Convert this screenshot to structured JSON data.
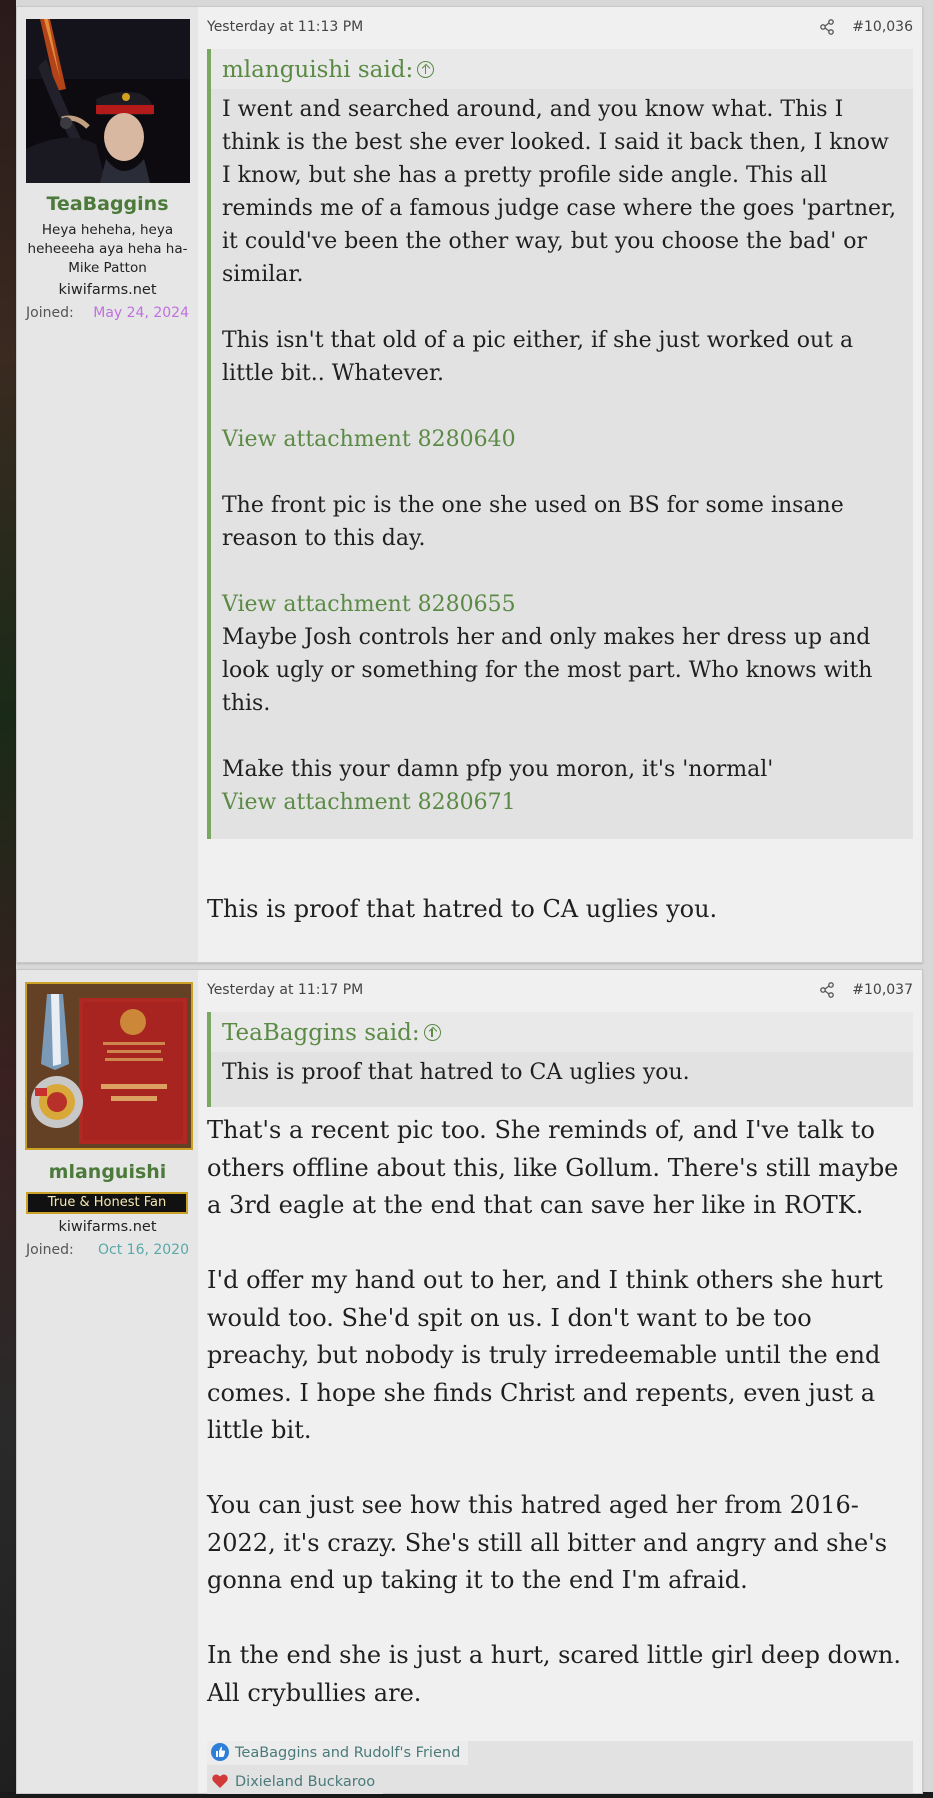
{
  "posts": [
    {
      "author": {
        "name": "TeaBaggins",
        "title": "Heya heheha, heya heheeeha aya heha ha- Mike Patton",
        "site": "kiwifarms.net",
        "joined_label": "Joined:",
        "joined_date": "May 24, 2024"
      },
      "date": "Yesterday at 11:13 PM",
      "number": "#10,036",
      "quote": {
        "author": "mlanguishi said:",
        "paragraphs": [
          "I went and searched around, and you know what. This I think is the best she ever looked. I said it back then, I know I know, but she has a pretty profile side angle. This all reminds me of a famous judge case where the goes 'partner, it could've been the other way, but you choose the bad' or similar.",
          "This isn't that old of a pic either, if she just worked out a little bit.. Whatever."
        ],
        "attachment_1": "View attachment 8280640",
        "paragraph_3": "The front pic is the one she used on BS for some insane reason to this day.",
        "attachment_2": "View attachment 8280655",
        "paragraph_4": "Maybe Josh controls her and only makes her dress up and look ugly or something for the most part. Who knows with this.",
        "paragraph_5": "Make this your damn pfp you moron, it's 'normal'",
        "attachment_3": "View attachment 8280671"
      },
      "body": "This is proof that hatred to CA uglies you."
    },
    {
      "author": {
        "name": "mlanguishi",
        "badge": "True & Honest Fan",
        "site": "kiwifarms.net",
        "joined_label": "Joined:",
        "joined_date": "Oct 16, 2020"
      },
      "date": "Yesterday at 11:17 PM",
      "number": "#10,037",
      "quote": {
        "author": "TeaBaggins said:",
        "text": "This is proof that hatred to CA uglies you."
      },
      "paragraphs": [
        "That's a recent pic too. She reminds of, and I've talk to others offline about this, like Gollum. There's still maybe a 3rd eagle at the end that can save her like in ROTK.",
        "I'd offer my hand out to her, and I think others she hurt would too. She'd spit on us. I don't want to be too preachy, but nobody is truly irredeemable until the end comes. I hope she finds Christ and repents, even just a little bit.",
        "You can just see how this hatred aged her from 2016-2022, it's crazy. She's still all bitter and angry and she's gonna end up taking it to the end I'm afraid.",
        "In the end she is just a hurt, scared little girl deep down. All crybullies are."
      ],
      "reactions": [
        {
          "icon": "thumbs-up-icon",
          "color": "#2f7fd8",
          "text": "TeaBaggins and Rudolf's Friend"
        },
        {
          "icon": "heart-icon",
          "color": "#d23a3a",
          "text": "Dixieland Buckaroo"
        }
      ]
    }
  ],
  "colors": {
    "username": "#4b7a3a",
    "quote_accent": "#7aa862",
    "joined_date_1": "#c070e0",
    "joined_date_2": "#5aa8a8"
  }
}
